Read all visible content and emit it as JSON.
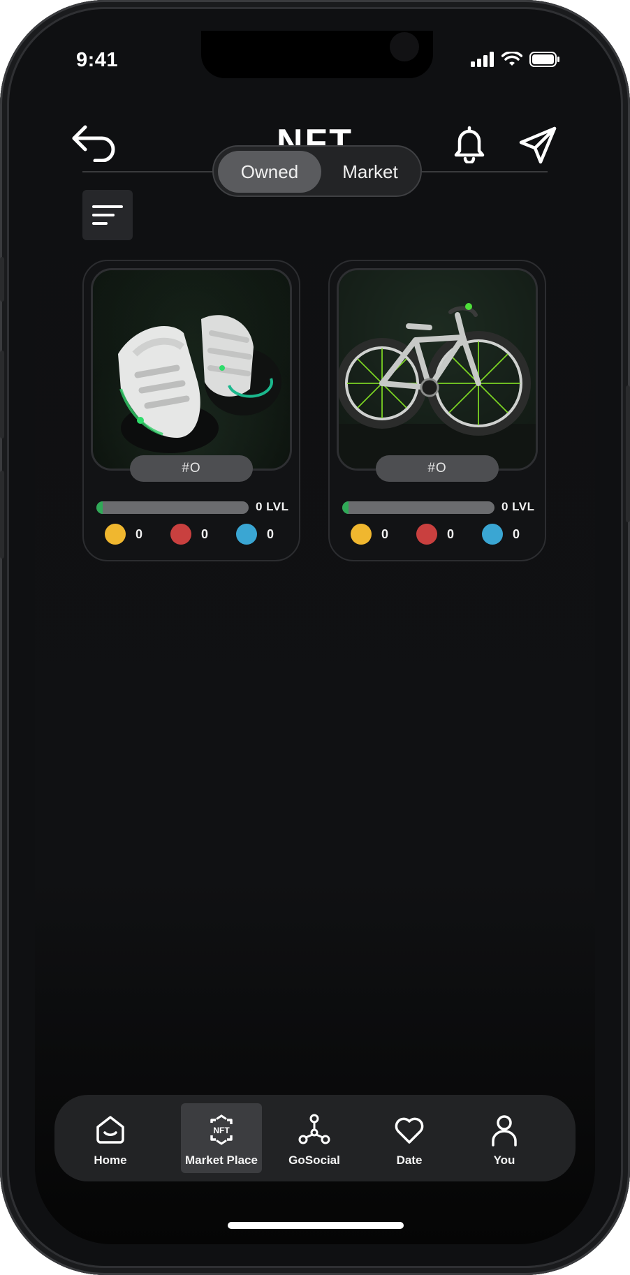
{
  "status_bar": {
    "time": "9:41"
  },
  "header": {
    "title": "NFT"
  },
  "segments": {
    "active": "Owned",
    "inactive": "Market"
  },
  "cards": [
    {
      "token": "#O",
      "level_text": "0 LVL",
      "level_progress": 0.04,
      "stats": [
        "0",
        "0",
        "0"
      ],
      "image": "white-sneakers"
    },
    {
      "token": "#O",
      "level_text": "0 LVL",
      "level_progress": 0.04,
      "stats": [
        "0",
        "0",
        "0"
      ],
      "image": "bicycle"
    }
  ],
  "stat_colors": [
    "#f0b72f",
    "#c9403f",
    "#3aa6d3"
  ],
  "accent": "#2faa57",
  "nav": {
    "items": [
      {
        "label": "Home",
        "icon": "home-icon"
      },
      {
        "label": "Market Place",
        "icon": "nft-icon"
      },
      {
        "label": "GoSocial",
        "icon": "network-icon"
      },
      {
        "label": "Date",
        "icon": "heart-icon"
      },
      {
        "label": "You",
        "icon": "user-icon"
      }
    ],
    "active": "Market Place"
  }
}
